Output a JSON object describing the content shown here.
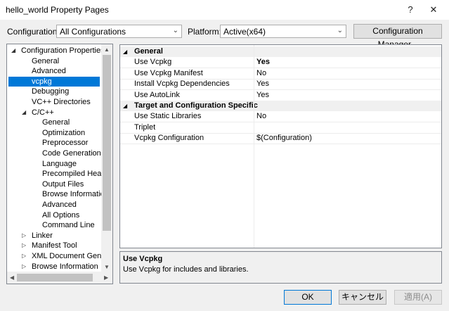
{
  "window": {
    "title": "hello_world Property Pages",
    "help_glyph": "?",
    "close_glyph": "✕"
  },
  "toolbar": {
    "configuration_label": "Configuration:",
    "configuration_value": "All Configurations",
    "platform_label": "Platform:",
    "platform_value": "Active(x64)",
    "config_manager_label": "Configuration Manager..."
  },
  "tree": {
    "items": [
      {
        "label": "Configuration Properties",
        "expanded": true
      },
      {
        "label": "General"
      },
      {
        "label": "Advanced"
      },
      {
        "label": "vcpkg",
        "selected": true
      },
      {
        "label": "Debugging"
      },
      {
        "label": "VC++ Directories"
      },
      {
        "label": "C/C++",
        "expanded": true
      },
      {
        "label": "General"
      },
      {
        "label": "Optimization"
      },
      {
        "label": "Preprocessor"
      },
      {
        "label": "Code Generation"
      },
      {
        "label": "Language"
      },
      {
        "label": "Precompiled Heade"
      },
      {
        "label": "Output Files"
      },
      {
        "label": "Browse Information"
      },
      {
        "label": "Advanced"
      },
      {
        "label": "All Options"
      },
      {
        "label": "Command Line"
      },
      {
        "label": "Linker",
        "expanded": false
      },
      {
        "label": "Manifest Tool",
        "expanded": false
      },
      {
        "label": "XML Document Genera",
        "expanded": false
      },
      {
        "label": "Browse Information",
        "expanded": false
      }
    ]
  },
  "grid": {
    "categories": [
      {
        "name": "General",
        "rows": [
          {
            "name": "Use Vcpkg",
            "value": "Yes",
            "bold": true
          },
          {
            "name": "Use Vcpkg Manifest",
            "value": "No"
          },
          {
            "name": "Install Vcpkg Dependencies",
            "value": "Yes"
          },
          {
            "name": "Use AutoLink",
            "value": "Yes"
          }
        ]
      },
      {
        "name": "Target and Configuration Specific",
        "rows": [
          {
            "name": "Use Static Libraries",
            "value": "No"
          },
          {
            "name": "Triplet",
            "value": ""
          },
          {
            "name": "Vcpkg Configuration",
            "value": "$(Configuration)"
          }
        ]
      }
    ]
  },
  "description": {
    "title": "Use Vcpkg",
    "text": "Use Vcpkg for includes and libraries."
  },
  "buttons": {
    "ok": "OK",
    "cancel": "キャンセル",
    "apply": "適用(A)"
  }
}
